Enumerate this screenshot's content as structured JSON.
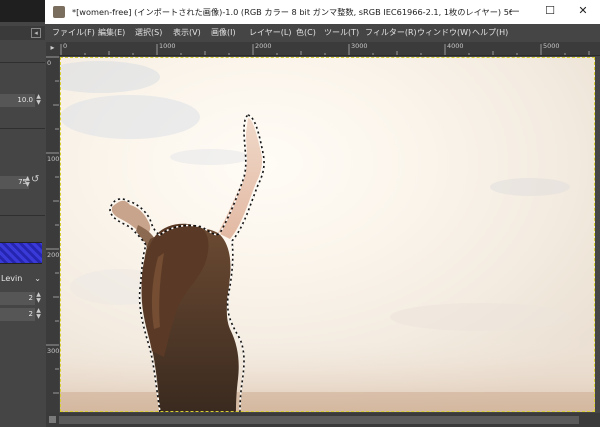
{
  "tool_options": {
    "size_value": "10.0",
    "opacity_value": "75",
    "method_label": "Levin",
    "spin_a": "2",
    "spin_b": "2"
  },
  "window": {
    "title": "*[women-free] (インポートされた画像)-1.0 (RGB カラー 8 bit ガンマ整数, sRGB IEC61966-2.1, 1枚のレイヤー) 5608x3...",
    "minimize": "—",
    "maximize": "☐",
    "close": "✕"
  },
  "menu": [
    "ファイル(F)",
    "編集(E)",
    "選択(S)",
    "表示(V)",
    "画像(I)",
    "レイヤー(L)",
    "色(C)",
    "ツール(T)",
    "フィルター(R)",
    "ウィンドウ(W)",
    "ヘルプ(H)"
  ],
  "ruler": {
    "h_labels": [
      "0",
      "1000",
      "2000",
      "3000",
      "4000",
      "5000"
    ],
    "v_labels": [
      "0",
      "1000",
      "2000",
      "3000"
    ]
  },
  "canvas": {
    "subject": "woman raising arms against bright sky",
    "selection": "foreground select outline"
  },
  "colors": {
    "ui_dark": "#454545",
    "canvas_border": "#d8cf30",
    "gradient_swatch": "#3a3ad8"
  }
}
